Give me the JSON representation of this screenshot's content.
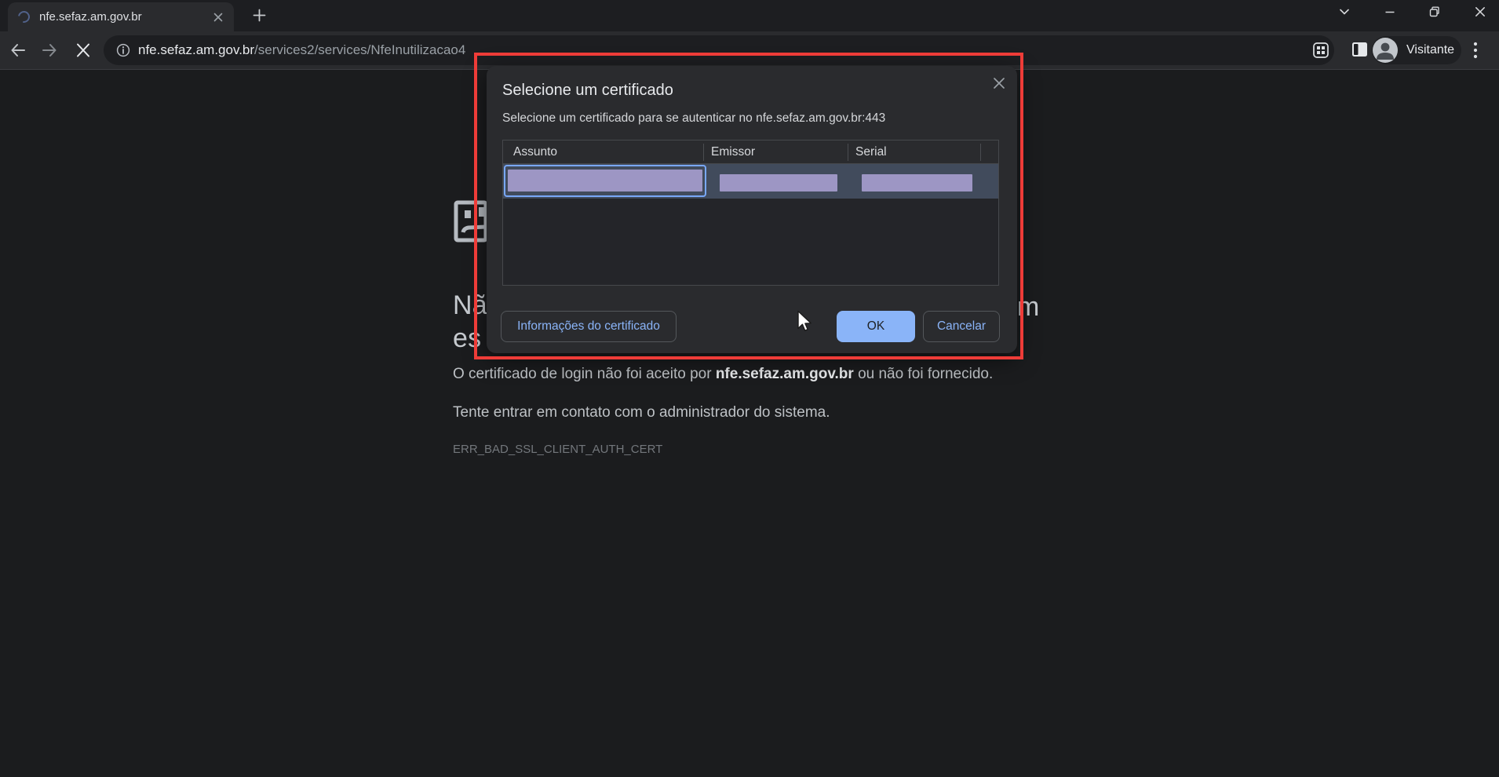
{
  "tabbar": {
    "tab_title": "nfe.sefaz.am.gov.br"
  },
  "toolbar": {
    "url_domain": "nfe.sefaz.am.gov.br",
    "url_path": "/services2/services/NfeInutilizacao4",
    "profile_label": "Visitante"
  },
  "dialog": {
    "title": "Selecione um certificado",
    "subtitle": "Selecione um certificado para se autenticar no nfe.sefaz.am.gov.br:443",
    "columns": [
      "Assunto",
      "Emissor",
      "Serial"
    ],
    "info_button": "Informações do certificado",
    "ok_button": "OK",
    "cancel_button": "Cancelar"
  },
  "page": {
    "heading_fragment_start": "Nã",
    "heading_fragment_end": "m",
    "heading_fragment_line2": "es",
    "body_text_before": "O certificado de login não foi aceito por ",
    "body_text_domain": "nfe.sefaz.am.gov.br",
    "body_text_after": " ou não foi fornecido.",
    "advice_text": "Tente entrar em contato com o administrador do sistema.",
    "error_code": "ERR_BAD_SSL_CLIENT_AUTH_CERT"
  },
  "colors": {
    "annotation_red": "#ee3c38",
    "accent_blue": "#8ab4f8",
    "focus_ring_blue": "#79a8f8",
    "redaction_purple": "#9d96c4",
    "selected_row_blue": "#414b5c"
  }
}
